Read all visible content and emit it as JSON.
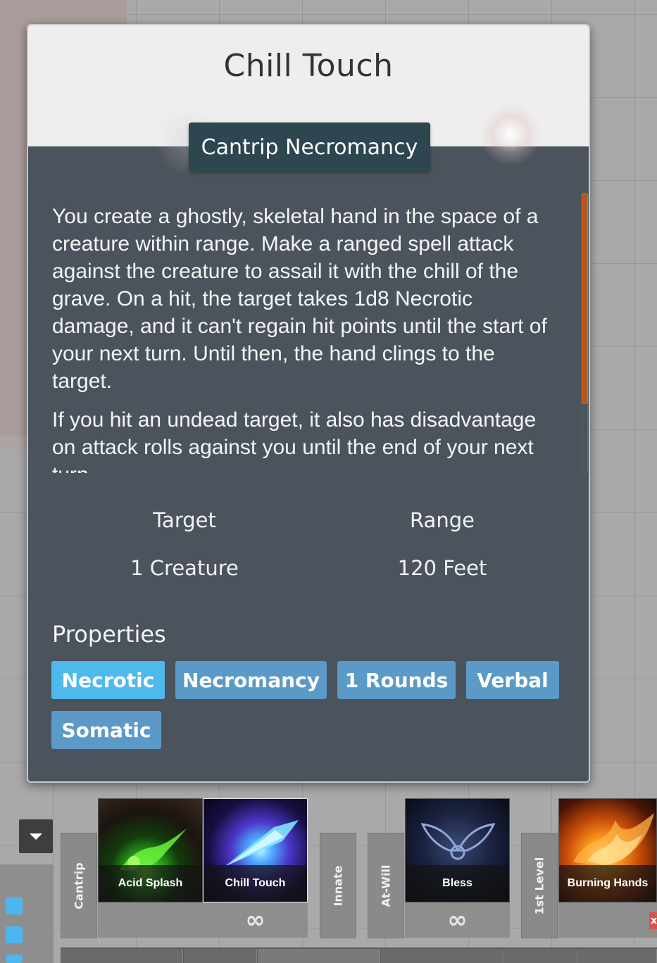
{
  "spell_tooltip": {
    "title": "Chill Touch",
    "school": "Cantrip Necromancy",
    "description": [
      "You create a ghostly, skeletal hand in the space of a creature within range. Make a ranged spell attack against the creature to assail it with the chill of the grave. On a hit, the target takes 1d8 Necrotic damage, and it can't regain hit points until the start of your next turn. Until then, the hand clings to the target.",
      "If you hit an undead target, it also has disadvantage on attack rolls against you until the end of your next turn."
    ],
    "stats": {
      "target_label": "Target",
      "target_value": "1 Creature",
      "range_label": "Range",
      "range_value": "120 Feet"
    },
    "properties_heading": "Properties",
    "properties": [
      "Necrotic",
      "Necromancy",
      "1 Rounds",
      "Verbal",
      "Somatic"
    ]
  },
  "hotbar": {
    "groups": [
      "Cantrip",
      "Innate",
      "At-Will",
      "1st Level"
    ],
    "slots": [
      {
        "name": "Acid Splash",
        "uses": "∞"
      },
      {
        "name": "Chill Touch",
        "uses": "∞"
      },
      {
        "name": "Bless",
        "uses": "∞"
      },
      {
        "name": "Burning Hands",
        "uses": ""
      }
    ],
    "close_glyph": "x"
  },
  "colors": {
    "card_bg": "#4b535c",
    "header_bg": "#efeeee",
    "school_tab": "#2d4650",
    "chip": "#5b9ac7",
    "chip_active": "#4fb9ec",
    "scrollbar_accent": "#b5541f"
  }
}
